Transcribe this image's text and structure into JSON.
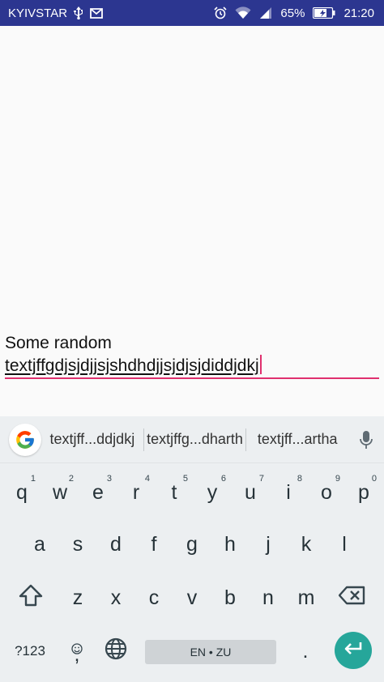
{
  "status_bar": {
    "carrier": "KYIVSTAR",
    "battery_percent": "65%",
    "time": "21:20",
    "bg_color": "#2c3690",
    "icons": [
      "usb-icon",
      "mail-icon",
      "alarm-icon",
      "wifi-icon",
      "signal-icon",
      "battery-icon"
    ]
  },
  "text_field": {
    "line1": "Some random",
    "line2": "textjffgdjsjdjjsjshdhdjjsjdjsjdiddjdkj",
    "accent_color": "#e0306e"
  },
  "keyboard": {
    "suggestions": [
      "textjff...ddjdkj",
      "textjffg...dharth",
      "textjff...artha"
    ],
    "row1": [
      {
        "key": "q",
        "hint": "1"
      },
      {
        "key": "w",
        "hint": "2"
      },
      {
        "key": "e",
        "hint": "3"
      },
      {
        "key": "r",
        "hint": "4"
      },
      {
        "key": "t",
        "hint": "5"
      },
      {
        "key": "y",
        "hint": "6"
      },
      {
        "key": "u",
        "hint": "7"
      },
      {
        "key": "i",
        "hint": "8"
      },
      {
        "key": "o",
        "hint": "9"
      },
      {
        "key": "p",
        "hint": "0"
      }
    ],
    "row2": [
      "a",
      "s",
      "d",
      "f",
      "g",
      "h",
      "j",
      "k",
      "l"
    ],
    "row3": [
      "z",
      "x",
      "c",
      "v",
      "b",
      "n",
      "m"
    ],
    "symbols_label": "?123",
    "space_label": "EN • ZU",
    "comma": ",",
    "period": ".",
    "enter_color": "#26a69a"
  }
}
